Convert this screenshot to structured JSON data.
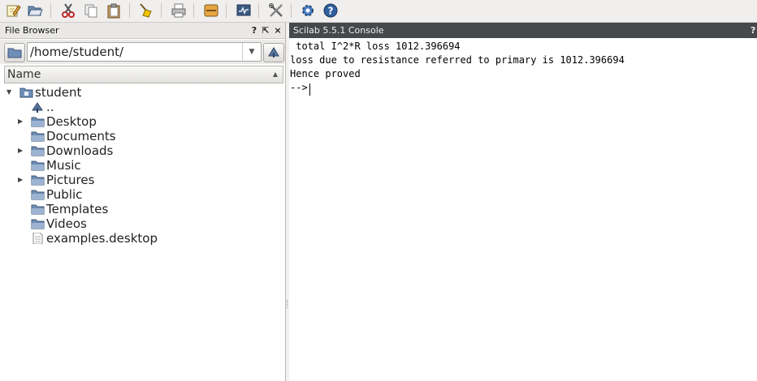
{
  "toolbar": {
    "icons": [
      "edit-icon",
      "open-folder-icon",
      "cut-icon",
      "copy-icon",
      "paste-icon",
      "clear-console-icon",
      "print-icon",
      "variable-browser-icon",
      "scinotes-icon",
      "module-manager-icon",
      "gear-icon",
      "help-icon"
    ]
  },
  "file_browser": {
    "title": "File Browser",
    "title_buttons": [
      "?",
      "⇱",
      "×"
    ],
    "path_value": "/home/student/",
    "column_header": "Name",
    "tree": [
      {
        "label": "student",
        "icon": "home-folder-icon",
        "expanded": true
      },
      {
        "label": "..",
        "icon": "parent-dir-icon"
      },
      {
        "label": "Desktop",
        "icon": "folder-icon",
        "expandable": true
      },
      {
        "label": "Documents",
        "icon": "folder-icon"
      },
      {
        "label": "Downloads",
        "icon": "folder-icon",
        "expandable": true
      },
      {
        "label": "Music",
        "icon": "folder-icon"
      },
      {
        "label": "Pictures",
        "icon": "folder-icon",
        "expandable": true
      },
      {
        "label": "Public",
        "icon": "folder-icon"
      },
      {
        "label": "Templates",
        "icon": "folder-icon"
      },
      {
        "label": "Videos",
        "icon": "folder-icon"
      },
      {
        "label": "examples.desktop",
        "icon": "file-icon"
      }
    ]
  },
  "console": {
    "title": "Scilab 5.5.1 Console",
    "title_button": "?",
    "lines": [
      " total I^2*R loss 1012.396694",
      "loss due to resistance referred to primary is 1012.396694",
      "Hence proved",
      "-->"
    ]
  },
  "colors": {
    "folder": "#6f8fb7",
    "console_title_bg": "#45494c"
  }
}
